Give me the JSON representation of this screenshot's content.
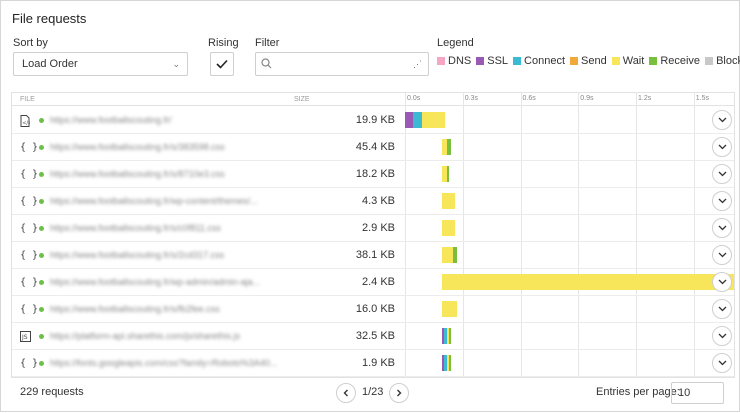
{
  "title": "File requests",
  "sort": {
    "label": "Sort by",
    "value": "Load Order"
  },
  "rising": {
    "label": "Rising",
    "checked": true
  },
  "filter": {
    "label": "Filter",
    "value": "",
    "placeholder": ""
  },
  "legend": {
    "label": "Legend",
    "items": [
      {
        "name": "DNS",
        "color": "#f4a6c2"
      },
      {
        "name": "SSL",
        "color": "#9b59b6"
      },
      {
        "name": "Connect",
        "color": "#3cb9d3"
      },
      {
        "name": "Send",
        "color": "#f0a93a"
      },
      {
        "name": "Wait",
        "color": "#f7e65a"
      },
      {
        "name": "Receive",
        "color": "#78bf3d"
      },
      {
        "name": "Blocked",
        "color": "#c8c8c8"
      }
    ]
  },
  "columns": {
    "file": "FILE",
    "size": "SIZE"
  },
  "timeline_ticks": [
    "0.0s",
    "0.3s",
    "0.6s",
    "0.9s",
    "1.2s",
    "1.5s"
  ],
  "rows": [
    {
      "icon": "document-icon",
      "icon_glyph": "",
      "url": "https://www.footballscouting.fr/",
      "size": "19.9 KB",
      "timing": [
        {
          "type": "SSL",
          "start": 0,
          "dur": 0.04
        },
        {
          "type": "Connect",
          "start": 0.04,
          "dur": 0.05
        },
        {
          "type": "Wait",
          "start": 0.09,
          "dur": 0.12
        }
      ]
    },
    {
      "icon": "code-icon",
      "icon_glyph": "{ }",
      "url": "https://www.footballscouting.fr/s/383598.css",
      "size": "45.4 KB",
      "timing": [
        {
          "type": "Wait",
          "start": 0.19,
          "dur": 0.03
        },
        {
          "type": "Receive",
          "start": 0.22,
          "dur": 0.02
        }
      ]
    },
    {
      "icon": "code-icon",
      "icon_glyph": "{ }",
      "url": "https://www.footballscouting.fr/s/8710e3.css",
      "size": "18.2 KB",
      "timing": [
        {
          "type": "Wait",
          "start": 0.19,
          "dur": 0.03
        },
        {
          "type": "Receive",
          "start": 0.22,
          "dur": 0.01
        }
      ]
    },
    {
      "icon": "code-icon",
      "icon_glyph": "{ }",
      "url": "https://www.footballscouting.fr/wp-content/themes/...",
      "size": "4.3 KB",
      "timing": [
        {
          "type": "Wait",
          "start": 0.19,
          "dur": 0.07
        }
      ]
    },
    {
      "icon": "code-icon",
      "icon_glyph": "{ }",
      "url": "https://www.footballscouting.fr/s/c0f811.css",
      "size": "2.9 KB",
      "timing": [
        {
          "type": "Wait",
          "start": 0.19,
          "dur": 0.07
        }
      ]
    },
    {
      "icon": "code-icon",
      "icon_glyph": "{ }",
      "url": "https://www.footballscouting.fr/s/2cd317.css",
      "size": "38.1 KB",
      "timing": [
        {
          "type": "Wait",
          "start": 0.19,
          "dur": 0.06
        },
        {
          "type": "Receive",
          "start": 0.25,
          "dur": 0.02
        }
      ]
    },
    {
      "icon": "code-icon",
      "icon_glyph": "{ }",
      "url": "https://www.footballscouting.fr/wp-admin/admin-aja...",
      "size": "2.4 KB",
      "timing": [
        {
          "type": "Wait",
          "start": 0.19,
          "dur": 1.58
        }
      ]
    },
    {
      "icon": "code-icon",
      "icon_glyph": "{ }",
      "url": "https://www.footballscouting.fr/s/fb2fee.css",
      "size": "16.0 KB",
      "timing": [
        {
          "type": "Wait",
          "start": 0.19,
          "dur": 0.08
        }
      ]
    },
    {
      "icon": "image-icon",
      "icon_glyph": "",
      "url": "https://platform-api.sharethis.com/js/sharethis.js",
      "size": "32.5 KB",
      "timing": [
        {
          "type": "SSL",
          "start": 0.19,
          "dur": 0.01
        },
        {
          "type": "Connect",
          "start": 0.2,
          "dur": 0.02
        },
        {
          "type": "Wait",
          "start": 0.22,
          "dur": 0.01
        },
        {
          "type": "Receive",
          "start": 0.23,
          "dur": 0.01
        }
      ]
    },
    {
      "icon": "code-icon",
      "icon_glyph": "{ }",
      "url": "https://fonts.googleapis.com/css?family=Roboto%3A40...",
      "size": "1.9 KB",
      "timing": [
        {
          "type": "SSL",
          "start": 0.19,
          "dur": 0.01
        },
        {
          "type": "Connect",
          "start": 0.2,
          "dur": 0.02
        },
        {
          "type": "Wait",
          "start": 0.22,
          "dur": 0.01
        },
        {
          "type": "Receive",
          "start": 0.23,
          "dur": 0.01
        }
      ]
    }
  ],
  "footer": {
    "count": "229 requests",
    "page": "1/23",
    "entries_label": "Entries per page:",
    "entries_value": "10"
  }
}
